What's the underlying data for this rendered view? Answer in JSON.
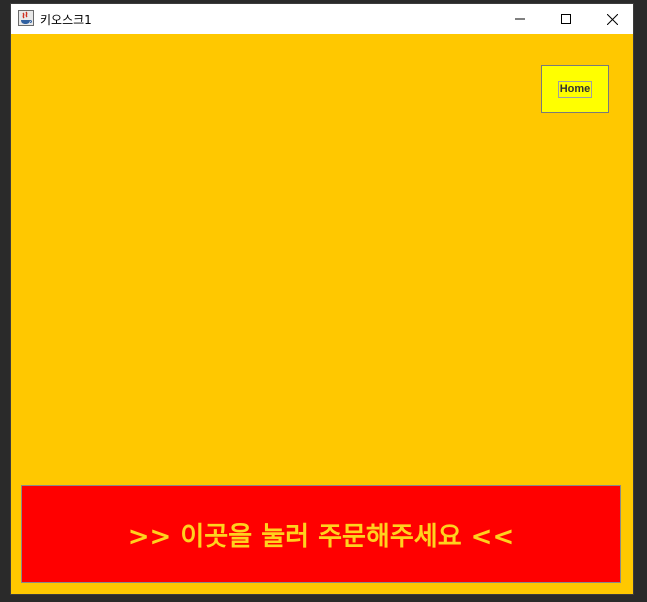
{
  "window": {
    "title": "키오스크1",
    "controls": {
      "minimize_icon": "minimize-icon",
      "maximize_icon": "maximize-icon",
      "close_icon": "close-icon"
    }
  },
  "content": {
    "background_color": "#ffc800",
    "home_button": {
      "label": "Home",
      "background_color": "#ffff00"
    },
    "order_button": {
      "label": ">> 이곳을 눌러 주문해주세요 <<",
      "background_color": "#ff0000",
      "text_color": "#ffd21e"
    }
  }
}
